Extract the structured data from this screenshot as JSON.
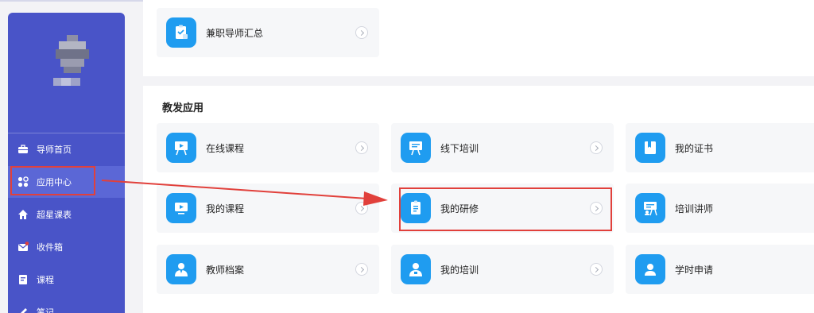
{
  "sidebar": {
    "items": [
      {
        "label": "导师首页",
        "icon": "briefcase-icon",
        "active": false
      },
      {
        "label": "应用中心",
        "icon": "apps-icon",
        "active": true
      },
      {
        "label": "超星课表",
        "icon": "home-icon",
        "active": false
      },
      {
        "label": "收件箱",
        "icon": "mail-icon",
        "active": false
      },
      {
        "label": "课程",
        "icon": "book-icon",
        "active": false
      },
      {
        "label": "笔记",
        "icon": "pen-icon",
        "active": false
      }
    ]
  },
  "top_card": {
    "label": "兼职导师汇总",
    "icon": "clipboard-icon"
  },
  "section": {
    "title": "教发应用",
    "cards": [
      {
        "label": "在线课程",
        "icon": "presentation-icon"
      },
      {
        "label": "线下培训",
        "icon": "board-icon"
      },
      {
        "label": "我的证书",
        "icon": "certificate-icon"
      },
      {
        "label": "我的课程",
        "icon": "monitor-play-icon"
      },
      {
        "label": "我的研修",
        "icon": "document-icon"
      },
      {
        "label": "培训讲师",
        "icon": "lecturer-icon"
      },
      {
        "label": "教师档案",
        "icon": "teacher-icon"
      },
      {
        "label": "我的培训",
        "icon": "trainee-icon"
      },
      {
        "label": "学时申请",
        "icon": "user-badge-icon"
      }
    ]
  },
  "colors": {
    "sidebar": "#4954c8",
    "sidebar_active": "#5b67d6",
    "icon_blue": "#1f9cf0",
    "annotation_red": "#e1403b",
    "notification_dot": "#e1403b"
  }
}
